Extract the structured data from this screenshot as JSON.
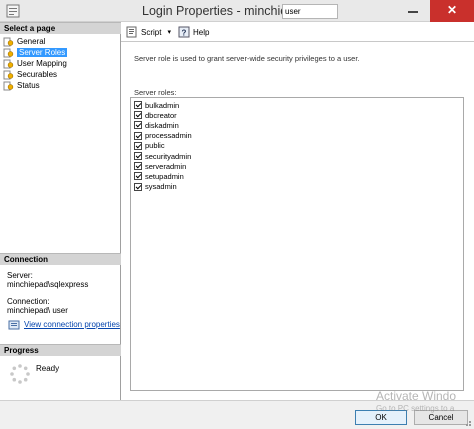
{
  "window": {
    "title": "Login Properties - minchiepad\\",
    "title_user": "user"
  },
  "sidebar": {
    "select_page_header": "Select a page",
    "items": [
      {
        "label": "General",
        "icon": "page-gear-icon"
      },
      {
        "label": "Server Roles",
        "icon": "page-gear-icon",
        "selected": true
      },
      {
        "label": "User Mapping",
        "icon": "page-gear-icon"
      },
      {
        "label": "Securables",
        "icon": "page-gear-icon"
      },
      {
        "label": "Status",
        "icon": "page-gear-icon"
      }
    ],
    "connection_header": "Connection",
    "server_label": "Server:",
    "server_value": "minchiepad\\sqlexpress",
    "connection_label": "Connection:",
    "connection_value": "minchiepad\\ user",
    "view_link": "View connection properties",
    "progress_header": "Progress",
    "progress_status": "Ready"
  },
  "toolbar": {
    "script_label": "Script",
    "help_label": "Help"
  },
  "main": {
    "description": "Server role is used to grant server-wide security privileges to a user.",
    "roles_label": "Server roles:",
    "roles": [
      {
        "name": "bulkadmin",
        "checked": true
      },
      {
        "name": "dbcreator",
        "checked": true
      },
      {
        "name": "diskadmin",
        "checked": true
      },
      {
        "name": "processadmin",
        "checked": true
      },
      {
        "name": "public",
        "checked": true
      },
      {
        "name": "securityadmin",
        "checked": true
      },
      {
        "name": "serveradmin",
        "checked": true
      },
      {
        "name": "setupadmin",
        "checked": true
      },
      {
        "name": "sysadmin",
        "checked": true
      }
    ]
  },
  "footer": {
    "ok_label": "OK",
    "cancel_label": "Cancel",
    "watermark_line1": "Activate Windo",
    "watermark_line2": "Go to PC settings to a"
  },
  "colors": {
    "selection": "#3399ff",
    "close_button": "#c9302c",
    "link": "#0645ad"
  }
}
